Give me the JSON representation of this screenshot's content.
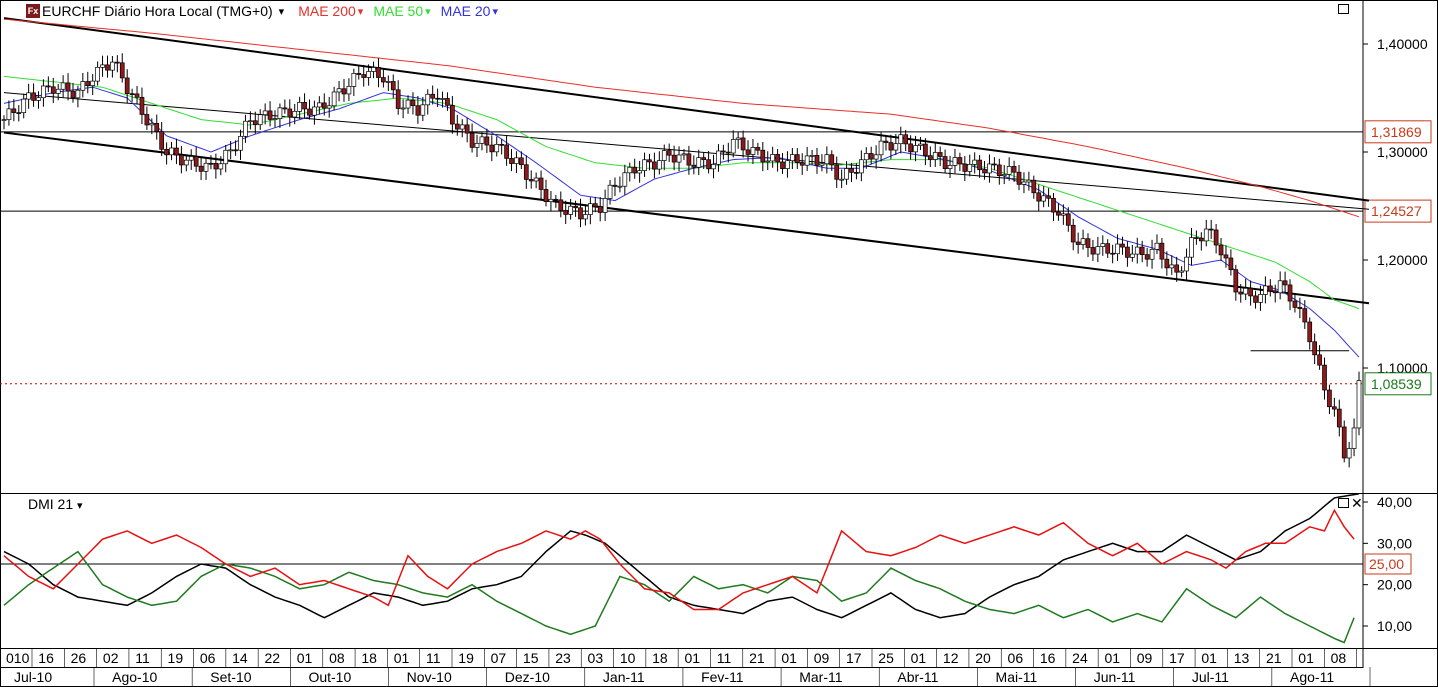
{
  "header": {
    "icon": "Fx",
    "symbol": "EURCHF Diário Hora Local (TMG+0)",
    "arrow": "▾",
    "ma200": "MAE 200",
    "ma50": "MAE 50",
    "ma20": "MAE 20"
  },
  "dmi_header": "DMI 21",
  "colors": {
    "ma200": "#e8302a",
    "ma50": "#33dd33",
    "ma20": "#3333dd",
    "up": "#ffffff",
    "down": "#8b1a1a",
    "dplus": "#e81010",
    "dminus": "#207a20",
    "adx": "#000000"
  },
  "chart_data": {
    "type": "candlestick",
    "price_axis": {
      "ylim": [
        1.0,
        1.42
      ],
      "ticks": [
        "1,40000",
        "1,30000",
        "1,20000",
        "1,10000"
      ]
    },
    "price_labels": [
      {
        "value": 1.31869,
        "text": "1,31869",
        "color": "#c83a1a"
      },
      {
        "value": 1.24527,
        "text": "1,24527",
        "color": "#c83a1a"
      },
      {
        "value": 1.08539,
        "text": "1,08539",
        "color": "#1a7a1a"
      }
    ],
    "horizontal_levels": [
      1.31869,
      1.24527,
      1.116
    ],
    "current_price": 1.08539,
    "close_path": [
      [
        0,
        1.33
      ],
      [
        5,
        1.35
      ],
      [
        10,
        1.36
      ],
      [
        15,
        1.355
      ],
      [
        18,
        1.37
      ],
      [
        22,
        1.385
      ],
      [
        25,
        1.36
      ],
      [
        29,
        1.33
      ],
      [
        33,
        1.3
      ],
      [
        38,
        1.29
      ],
      [
        42,
        1.285
      ],
      [
        46,
        1.3
      ],
      [
        50,
        1.33
      ],
      [
        55,
        1.335
      ],
      [
        60,
        1.34
      ],
      [
        64,
        1.34
      ],
      [
        68,
        1.355
      ],
      [
        73,
        1.375
      ],
      [
        77,
        1.37
      ],
      [
        80,
        1.345
      ],
      [
        84,
        1.34
      ],
      [
        88,
        1.355
      ],
      [
        91,
        1.33
      ],
      [
        95,
        1.31
      ],
      [
        100,
        1.305
      ],
      [
        104,
        1.29
      ],
      [
        108,
        1.27
      ],
      [
        112,
        1.25
      ],
      [
        117,
        1.243
      ],
      [
        121,
        1.25
      ],
      [
        124,
        1.27
      ],
      [
        128,
        1.285
      ],
      [
        132,
        1.29
      ],
      [
        135,
        1.298
      ],
      [
        140,
        1.29
      ],
      [
        144,
        1.29
      ],
      [
        148,
        1.31
      ],
      [
        152,
        1.3
      ],
      [
        157,
        1.29
      ],
      [
        162,
        1.293
      ],
      [
        167,
        1.292
      ],
      [
        170,
        1.275
      ],
      [
        174,
        1.29
      ],
      [
        178,
        1.305
      ],
      [
        182,
        1.31
      ],
      [
        187,
        1.3
      ],
      [
        191,
        1.29
      ],
      [
        195,
        1.288
      ],
      [
        200,
        1.285
      ],
      [
        205,
        1.28
      ],
      [
        210,
        1.26
      ],
      [
        214,
        1.245
      ],
      [
        218,
        1.215
      ],
      [
        222,
        1.21
      ],
      [
        226,
        1.21
      ],
      [
        231,
        1.205
      ],
      [
        234,
        1.21
      ],
      [
        238,
        1.185
      ],
      [
        241,
        1.215
      ],
      [
        244,
        1.228
      ],
      [
        247,
        1.21
      ],
      [
        250,
        1.175
      ],
      [
        253,
        1.165
      ],
      [
        256,
        1.17
      ],
      [
        259,
        1.178
      ],
      [
        262,
        1.16
      ],
      [
        265,
        1.13
      ],
      [
        268,
        1.08
      ],
      [
        270,
        1.06
      ],
      [
        272,
        1.02
      ],
      [
        274,
        1.04
      ],
      [
        275,
        1.085
      ]
    ],
    "ma20_path": [
      [
        0,
        1.345
      ],
      [
        10,
        1.355
      ],
      [
        18,
        1.36
      ],
      [
        25,
        1.35
      ],
      [
        33,
        1.315
      ],
      [
        42,
        1.3
      ],
      [
        50,
        1.315
      ],
      [
        60,
        1.33
      ],
      [
        68,
        1.34
      ],
      [
        77,
        1.355
      ],
      [
        84,
        1.35
      ],
      [
        91,
        1.34
      ],
      [
        100,
        1.315
      ],
      [
        108,
        1.29
      ],
      [
        117,
        1.26
      ],
      [
        124,
        1.255
      ],
      [
        132,
        1.275
      ],
      [
        140,
        1.285
      ],
      [
        148,
        1.293
      ],
      [
        157,
        1.295
      ],
      [
        167,
        1.285
      ],
      [
        174,
        1.285
      ],
      [
        182,
        1.3
      ],
      [
        191,
        1.293
      ],
      [
        200,
        1.283
      ],
      [
        210,
        1.265
      ],
      [
        218,
        1.24
      ],
      [
        226,
        1.22
      ],
      [
        234,
        1.21
      ],
      [
        241,
        1.195
      ],
      [
        247,
        1.2
      ],
      [
        253,
        1.18
      ],
      [
        259,
        1.172
      ],
      [
        265,
        1.155
      ],
      [
        270,
        1.135
      ],
      [
        275,
        1.11
      ]
    ],
    "ma50_path": [
      [
        0,
        1.37
      ],
      [
        10,
        1.365
      ],
      [
        20,
        1.36
      ],
      [
        30,
        1.345
      ],
      [
        40,
        1.33
      ],
      [
        50,
        1.325
      ],
      [
        60,
        1.335
      ],
      [
        70,
        1.345
      ],
      [
        80,
        1.35
      ],
      [
        90,
        1.345
      ],
      [
        100,
        1.33
      ],
      [
        110,
        1.305
      ],
      [
        120,
        1.29
      ],
      [
        130,
        1.285
      ],
      [
        140,
        1.285
      ],
      [
        150,
        1.29
      ],
      [
        160,
        1.29
      ],
      [
        170,
        1.288
      ],
      [
        180,
        1.293
      ],
      [
        190,
        1.293
      ],
      [
        200,
        1.285
      ],
      [
        210,
        1.27
      ],
      [
        220,
        1.255
      ],
      [
        230,
        1.24
      ],
      [
        240,
        1.225
      ],
      [
        250,
        1.21
      ],
      [
        258,
        1.198
      ],
      [
        265,
        1.18
      ],
      [
        270,
        1.163
      ],
      [
        275,
        1.155
      ]
    ],
    "ma200_path": [
      [
        0,
        1.423
      ],
      [
        30,
        1.41
      ],
      [
        60,
        1.395
      ],
      [
        90,
        1.38
      ],
      [
        120,
        1.36
      ],
      [
        150,
        1.345
      ],
      [
        180,
        1.335
      ],
      [
        200,
        1.322
      ],
      [
        220,
        1.305
      ],
      [
        240,
        1.285
      ],
      [
        255,
        1.268
      ],
      [
        265,
        1.255
      ],
      [
        275,
        1.24
      ]
    ],
    "trendlines": [
      {
        "from": [
          0,
          1.424
        ],
        "to": [
          275,
          1.255
        ],
        "width": 2
      },
      {
        "from": [
          0,
          1.318
        ],
        "to": [
          275,
          1.16
        ],
        "width": 2
      },
      {
        "from": [
          0,
          1.355
        ],
        "to": [
          275,
          1.247
        ],
        "width": 1
      }
    ],
    "dmi": {
      "ylim": [
        5,
        42
      ],
      "ticks": [
        "40,00",
        "30,00",
        "20,00",
        "10,00"
      ],
      "level": {
        "value": 25,
        "text": "25,00"
      },
      "dplus_path": [
        [
          0,
          27
        ],
        [
          5,
          22
        ],
        [
          10,
          19
        ],
        [
          15,
          25
        ],
        [
          20,
          31
        ],
        [
          25,
          33
        ],
        [
          30,
          30
        ],
        [
          35,
          32
        ],
        [
          40,
          29
        ],
        [
          45,
          25
        ],
        [
          50,
          22
        ],
        [
          55,
          24
        ],
        [
          60,
          20
        ],
        [
          65,
          21
        ],
        [
          70,
          19
        ],
        [
          75,
          17
        ],
        [
          78,
          15
        ],
        [
          82,
          27
        ],
        [
          86,
          22
        ],
        [
          90,
          19
        ],
        [
          95,
          25
        ],
        [
          100,
          28
        ],
        [
          105,
          30
        ],
        [
          110,
          33
        ],
        [
          115,
          31
        ],
        [
          118,
          33
        ],
        [
          121,
          31
        ],
        [
          125,
          25
        ],
        [
          130,
          19
        ],
        [
          135,
          18
        ],
        [
          140,
          14
        ],
        [
          145,
          14
        ],
        [
          150,
          18
        ],
        [
          155,
          20
        ],
        [
          160,
          22
        ],
        [
          165,
          18
        ],
        [
          170,
          33
        ],
        [
          175,
          28
        ],
        [
          180,
          27
        ],
        [
          185,
          29
        ],
        [
          190,
          32
        ],
        [
          195,
          30
        ],
        [
          200,
          32
        ],
        [
          205,
          34
        ],
        [
          210,
          32
        ],
        [
          215,
          35
        ],
        [
          220,
          30
        ],
        [
          225,
          27
        ],
        [
          230,
          30
        ],
        [
          235,
          25
        ],
        [
          240,
          28
        ],
        [
          245,
          26
        ],
        [
          248,
          24
        ],
        [
          252,
          28
        ],
        [
          256,
          30
        ],
        [
          260,
          30
        ],
        [
          265,
          34
        ],
        [
          268,
          33
        ],
        [
          270,
          38
        ],
        [
          272,
          34
        ],
        [
          274,
          31
        ]
      ],
      "dminus_path": [
        [
          0,
          15
        ],
        [
          5,
          20
        ],
        [
          10,
          24
        ],
        [
          15,
          28
        ],
        [
          20,
          20
        ],
        [
          25,
          17
        ],
        [
          30,
          15
        ],
        [
          35,
          16
        ],
        [
          40,
          22
        ],
        [
          45,
          25
        ],
        [
          50,
          24
        ],
        [
          55,
          22
        ],
        [
          60,
          19
        ],
        [
          65,
          20
        ],
        [
          70,
          23
        ],
        [
          75,
          21
        ],
        [
          80,
          20
        ],
        [
          85,
          18
        ],
        [
          90,
          17
        ],
        [
          95,
          20
        ],
        [
          100,
          16
        ],
        [
          105,
          13
        ],
        [
          110,
          10
        ],
        [
          115,
          8
        ],
        [
          120,
          10
        ],
        [
          125,
          22
        ],
        [
          130,
          20
        ],
        [
          135,
          16
        ],
        [
          140,
          22
        ],
        [
          145,
          19
        ],
        [
          150,
          20
        ],
        [
          155,
          18
        ],
        [
          160,
          22
        ],
        [
          165,
          21
        ],
        [
          170,
          16
        ],
        [
          175,
          18
        ],
        [
          180,
          24
        ],
        [
          185,
          21
        ],
        [
          190,
          19
        ],
        [
          195,
          16
        ],
        [
          200,
          14
        ],
        [
          205,
          13
        ],
        [
          210,
          15
        ],
        [
          215,
          12
        ],
        [
          220,
          14
        ],
        [
          225,
          11
        ],
        [
          230,
          13
        ],
        [
          235,
          11
        ],
        [
          240,
          19
        ],
        [
          245,
          15
        ],
        [
          250,
          12
        ],
        [
          255,
          17
        ],
        [
          260,
          13
        ],
        [
          265,
          10
        ],
        [
          270,
          7
        ],
        [
          272,
          6
        ],
        [
          274,
          12
        ]
      ],
      "adx_path": [
        [
          0,
          28
        ],
        [
          5,
          25
        ],
        [
          10,
          20
        ],
        [
          15,
          17
        ],
        [
          20,
          16
        ],
        [
          25,
          15
        ],
        [
          30,
          18
        ],
        [
          35,
          22
        ],
        [
          40,
          25
        ],
        [
          45,
          24
        ],
        [
          50,
          20
        ],
        [
          55,
          17
        ],
        [
          60,
          15
        ],
        [
          65,
          12
        ],
        [
          70,
          15
        ],
        [
          75,
          18
        ],
        [
          80,
          17
        ],
        [
          85,
          15
        ],
        [
          90,
          16
        ],
        [
          95,
          19
        ],
        [
          100,
          20
        ],
        [
          105,
          22
        ],
        [
          110,
          28
        ],
        [
          115,
          33
        ],
        [
          118,
          32
        ],
        [
          122,
          30
        ],
        [
          125,
          27
        ],
        [
          130,
          22
        ],
        [
          135,
          17
        ],
        [
          140,
          15
        ],
        [
          145,
          14
        ],
        [
          150,
          13
        ],
        [
          155,
          16
        ],
        [
          160,
          17
        ],
        [
          165,
          14
        ],
        [
          170,
          12
        ],
        [
          175,
          15
        ],
        [
          180,
          18
        ],
        [
          185,
          14
        ],
        [
          190,
          12
        ],
        [
          195,
          13
        ],
        [
          200,
          17
        ],
        [
          205,
          20
        ],
        [
          210,
          22
        ],
        [
          215,
          26
        ],
        [
          220,
          28
        ],
        [
          225,
          30
        ],
        [
          230,
          28
        ],
        [
          235,
          28
        ],
        [
          240,
          32
        ],
        [
          245,
          29
        ],
        [
          250,
          26
        ],
        [
          255,
          28
        ],
        [
          260,
          33
        ],
        [
          265,
          36
        ],
        [
          270,
          41
        ],
        [
          275,
          42
        ]
      ]
    },
    "x_day_labels": [
      "010",
      "16",
      "26",
      "02",
      "11",
      "19",
      "06",
      "14",
      "22",
      "01",
      "08",
      "18",
      "01",
      "11",
      "19",
      "07",
      "15",
      "23",
      "03",
      "10",
      "18",
      "01",
      "11",
      "21",
      "01",
      "09",
      "17",
      "25",
      "01",
      "12",
      "20",
      "06",
      "16",
      "24",
      "01",
      "09",
      "17",
      "01",
      "13",
      "21",
      "01",
      "08"
    ],
    "x_month_labels": [
      "Jul-10",
      "Ago-10",
      "Set-10",
      "Out-10",
      "Nov-10",
      "Dez-10",
      "Jan-11",
      "Fev-11",
      "Mar-11",
      "Abr-11",
      "Mai-11",
      "Jun-11",
      "Jul-11",
      "Ago-11"
    ]
  }
}
